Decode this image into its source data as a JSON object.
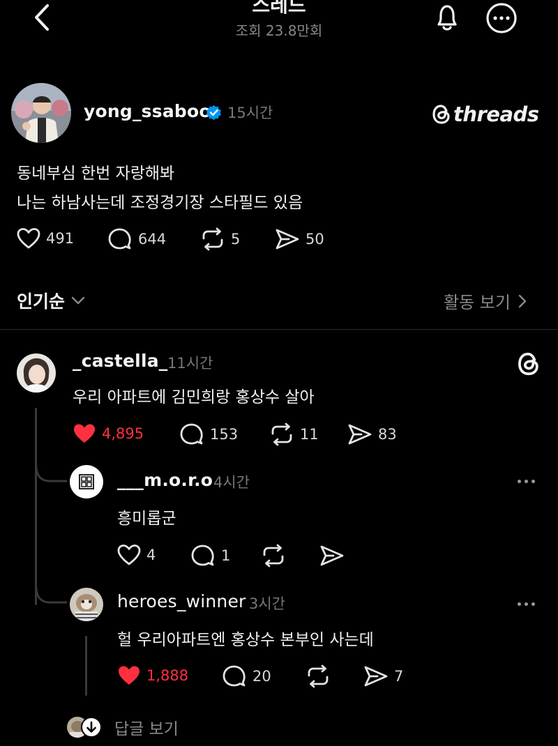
{
  "header": {
    "title": "스레드",
    "views": "조회 23.8만회"
  },
  "post": {
    "username": "yong_ssaboo",
    "time": "15시간",
    "brand": "threads",
    "lines": [
      "동네부심 한번 자랑해봐",
      "나는 하남사는데 조정경기장 스타필드 있음"
    ],
    "likes": "491",
    "comments": "644",
    "reposts": "5",
    "shares": "50"
  },
  "sort": {
    "label": "인기순",
    "activity": "활동 보기"
  },
  "replies": [
    {
      "username": "_castella_",
      "time": "11시간",
      "text": "우리 아파트에 김민희랑 홍상수 살아",
      "likes": "4,895",
      "comments": "153",
      "reposts": "11",
      "shares": "83"
    },
    {
      "username": "___m.o.r.o",
      "time": "4시간",
      "text": "흥미롭군",
      "likes": "4",
      "comments": "1"
    },
    {
      "username": "heroes_winner",
      "time": "3시간",
      "text": "헐 우리아파트엔 홍상수 본부인 사는데",
      "likes": "1,888",
      "comments": "20",
      "shares": "7"
    }
  ],
  "more_replies": "답글 보기",
  "colors": {
    "background": "#000000",
    "liked": "#ff3040",
    "verified": "#0095f6",
    "muted": "#8a8a8a"
  }
}
